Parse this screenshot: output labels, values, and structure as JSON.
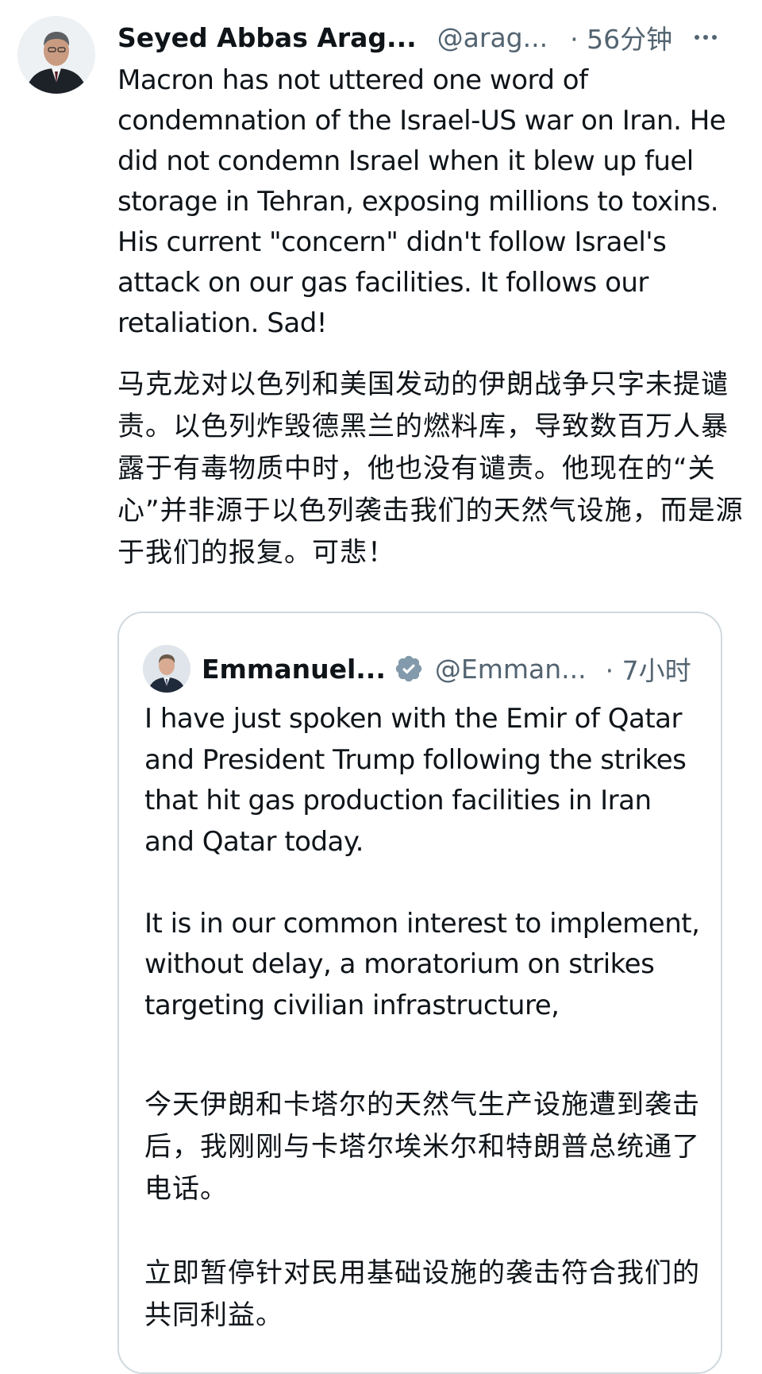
{
  "tweet": {
    "author_name": "Seyed Abbas Arag...",
    "author_handle": "@arag...",
    "time": "· 56分钟",
    "text_en": "Macron has not uttered one word of condemnation of the Israel-US war on Iran. He did not condemn Israel when it blew up fuel storage in Tehran, exposing millions to toxins. His current \"concern\" didn't follow Israel's attack on our gas facilities. It follows our retaliation. Sad!",
    "text_zh": "马克龙对以色列和美国发动的伊朗战争只字未提谴责。以色列炸毁德黑兰的燃料库，导致数百万人暴露于有毒物质中时，他也没有谴责。他现在的“关心”并非源于以色列袭击我们的天然气设施，而是源于我们的报复。可悲！"
  },
  "quoted_tweet": {
    "author_name": "Emmanuel...",
    "author_handle": "@Emman...",
    "time": "· 7小时",
    "text_en": "I have just spoken with the Emir of Qatar and President Trump following the strikes that hit gas production facilities in Iran and Qatar today.\n\nIt is in our common interest to implement, without delay, a moratorium on strikes targeting civilian infrastructure,",
    "text_zh": "今天伊朗和卡塔尔的天然气生产设施遭到袭击后，我刚刚与卡塔尔埃米尔和特朗普总统通了电话。\n\n立即暂停针对民用基础设施的袭击符合我们的共同利益。"
  },
  "icons": {
    "more": "more-horizontal-icon",
    "verified": "verified-badge-icon"
  },
  "colors": {
    "text": "#0f1419",
    "secondary": "#536471",
    "border": "#cfd9de",
    "verified": "#829aab"
  }
}
